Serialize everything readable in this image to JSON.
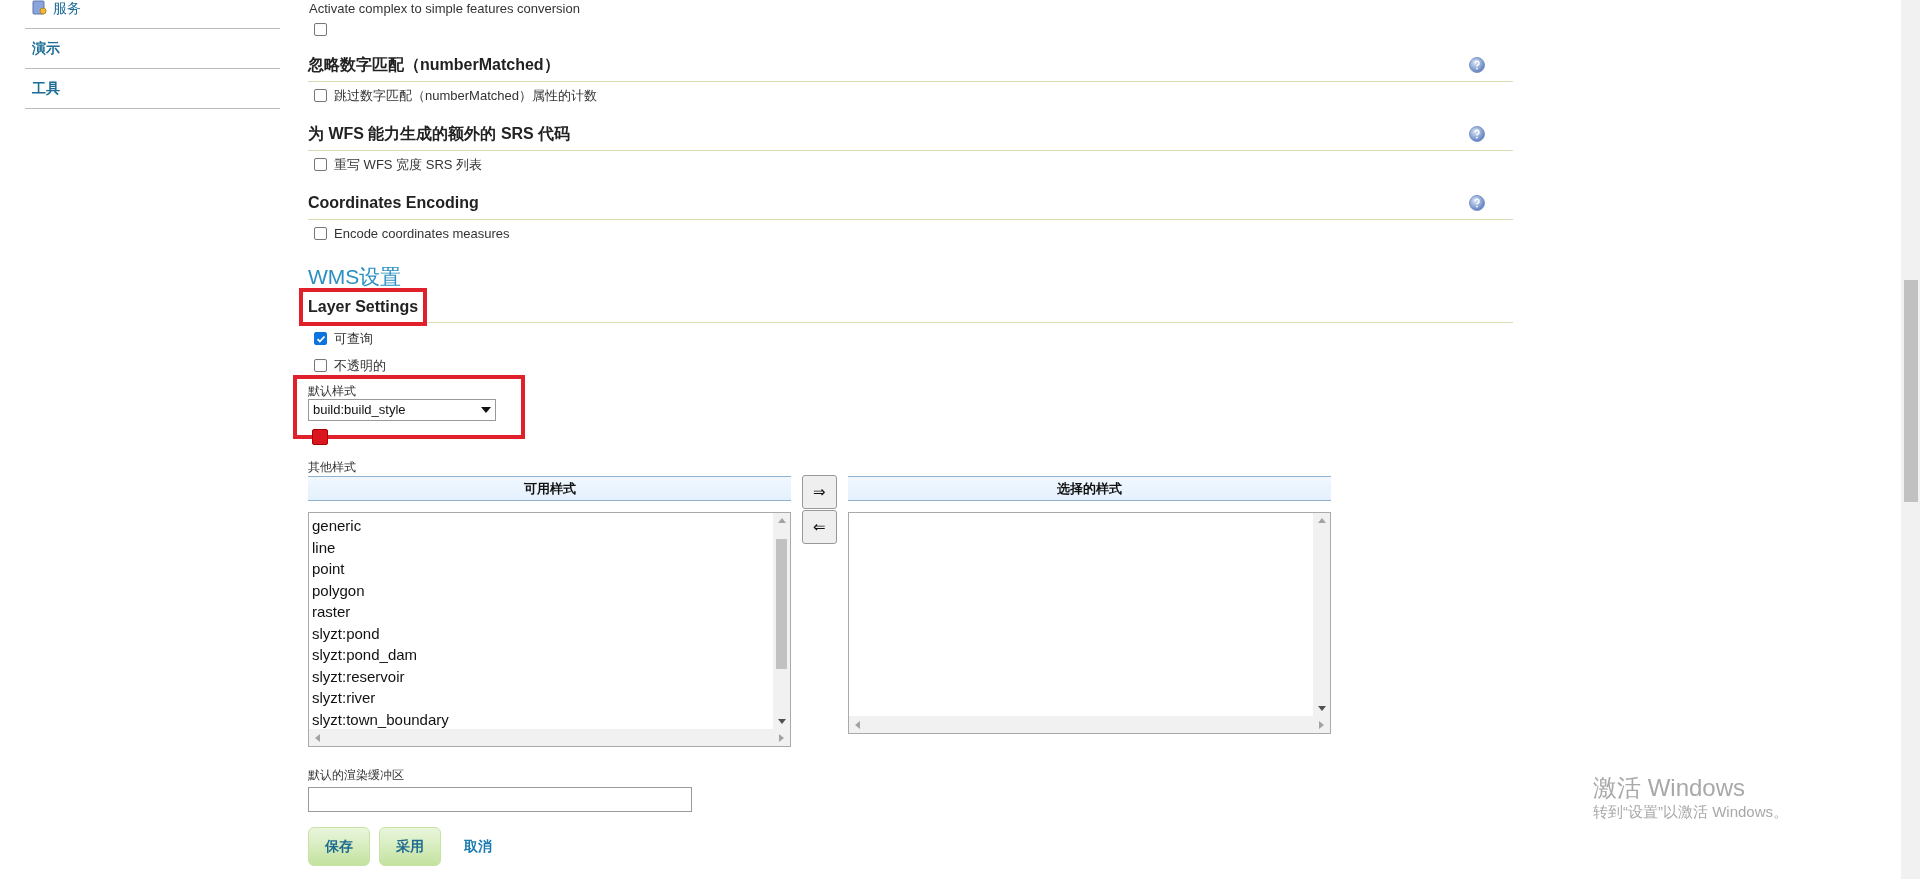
{
  "sidebar": {
    "items": [
      {
        "kind": "icon-link",
        "label": "服务"
      },
      {
        "kind": "link",
        "label": "演示"
      },
      {
        "kind": "link",
        "label": "工具"
      }
    ]
  },
  "wfs_tail": {
    "caption": "Activate complex to simple features conversion",
    "checked": false
  },
  "sections": [
    {
      "title": "忽略数字匹配（numberMatched）",
      "help": true,
      "options": [
        {
          "label": "跳过数字匹配（numberMatched）属性的计数",
          "checked": false
        }
      ]
    },
    {
      "title": "为 WFS 能力生成的额外的 SRS 代码",
      "help": true,
      "options": [
        {
          "label": "重写 WFS 宽度 SRS 列表",
          "checked": false
        }
      ]
    },
    {
      "title": "Coordinates Encoding",
      "help": true,
      "options": [
        {
          "label": "Encode coordinates measures",
          "checked": false
        }
      ]
    }
  ],
  "wms": {
    "title": "WMS设置",
    "layer_settings": {
      "title": "Layer Settings",
      "highlighted": true,
      "options": [
        {
          "label": "可查询",
          "checked": true
        },
        {
          "label": "不透明的",
          "checked": false
        }
      ],
      "default_style": {
        "label": "默认样式",
        "value": "build:build_style",
        "highlighted": true
      },
      "other_styles": {
        "label": "其他样式",
        "available": {
          "header": "可用样式",
          "items": [
            "generic",
            "line",
            "point",
            "polygon",
            "raster",
            "slyzt:pond",
            "slyzt:pond_dam",
            "slyzt:reservoir",
            "slyzt:river",
            "slyzt:town_boundary"
          ]
        },
        "move_right": "⇒",
        "move_left": "⇐",
        "selected": {
          "header": "选择的样式"
        }
      },
      "render_buffer": {
        "label": "默认的渲染缓冲区"
      }
    }
  },
  "actions": [
    {
      "kind": "button",
      "label": "保存"
    },
    {
      "kind": "button",
      "label": "采用"
    },
    {
      "kind": "link",
      "label": "取消"
    }
  ],
  "os_notice": {
    "title": "激活 Windows",
    "subtitle": "转到“设置”以激活 Windows。"
  }
}
